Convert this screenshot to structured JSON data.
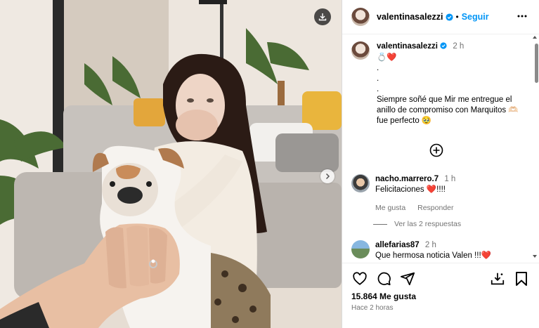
{
  "post": {
    "photo_alt": "Mujer con la mano en la boca, perro bulldog y mano con anillo de compromiso"
  },
  "header": {
    "username": "valentinasalezzi",
    "separator": "•",
    "follow_label": "Seguir"
  },
  "caption": {
    "username": "valentinasalezzi",
    "time": "2 h",
    "text": "💍❤️\n.\n.\n.\nSiempre soñé que Mir me entregue el anillo de compromiso con Marquitos 🫶🏻 fue perfecto 🥹"
  },
  "comments": [
    {
      "username": "nacho.marrero.7",
      "time": "1 h",
      "text": "Felicitaciones ❤️!!!!",
      "likes_label": "Me gusta",
      "reply_label": "Responder"
    },
    {
      "username": "allefarias87",
      "time": "2 h",
      "text": "Que hermosa noticia Valen !!!❤️"
    }
  ],
  "replies_label": "Ver las 2 respuestas",
  "footer": {
    "likes": "15.864 Me gusta",
    "ago": "Hace 2 horas"
  },
  "colors": {
    "accent": "#0095f6",
    "verified": "#0095f6",
    "muted": "#737373"
  }
}
